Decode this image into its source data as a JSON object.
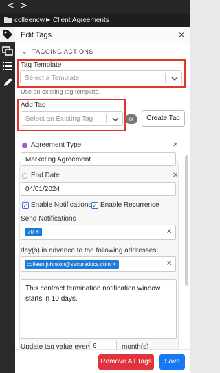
{
  "topbar": {
    "back": "<",
    "forward": ">"
  },
  "breadcrumb": {
    "folder": "colleencw",
    "separator": "▶",
    "current": "Client Agreements"
  },
  "panel": {
    "title": "Edit Tags",
    "section": "TAGGING ACTIONS",
    "tag_template": {
      "label": "Tag Template",
      "placeholder": "Select a Template",
      "hint": "Use an existing tag template."
    },
    "add_tag": {
      "label": "Add Tag",
      "placeholder": "Select an Existing Tag",
      "or": "or",
      "create_label": "Create Tag"
    },
    "fields": {
      "agreement_type": {
        "label": "Agreement Type",
        "value": "Marketing Agreement",
        "color": "#9b5fd6"
      },
      "end_date": {
        "label": "End Date",
        "value": "04/01/2024"
      },
      "enable_notifications": "Enable Notifications",
      "enable_recurrence": "Enable Recurrence",
      "send_notifications": {
        "label": "Send Notifications",
        "chip": "70"
      },
      "advance_label": "day(s) in advance to the following addresses:",
      "email_chip": "colleen.johnson@securedocs.com",
      "message": "This contract termination notification window starts in 10 days.",
      "update_prefix": "Update tag value every",
      "update_value": "6",
      "update_suffix": "month(s)"
    },
    "remove_all": "Remove All Tags",
    "save": "Save"
  },
  "colors": {
    "accent": "#1877f2",
    "danger": "#e0333b",
    "highlight": "#e8332a"
  }
}
